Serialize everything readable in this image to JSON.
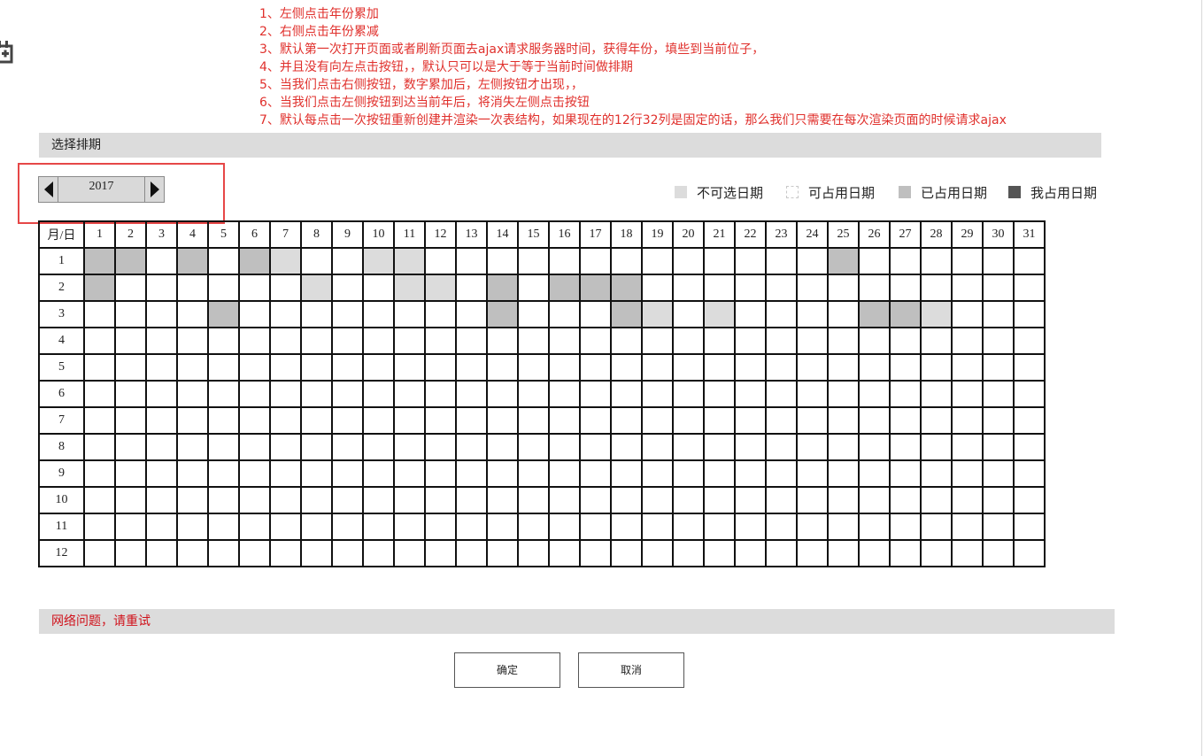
{
  "notes": [
    "1、左侧点击年份累加",
    "2、右侧点击年份累减",
    "3、默认第一次打开页面或者刷新页面去ajax请求服务器时间，获得年份，填些到当前位子，",
    "4、并且没有向左点击按钮，，默认只可以是大于等于当前时间做排期",
    "5、当我们点击右侧按钮，数字累加后，左侧按钮才出现，，",
    "6、当我们点击左侧按钮到达当前年后，将消失左侧点击按钮",
    "7、默认每点击一次按钮重新创建并渲染一次表结构，如果现在的12行32列是固定的话，那么我们只需要在每次渲染页面的时候请求ajax"
  ],
  "section_title": "选择排期",
  "year_picker": {
    "year": "2017"
  },
  "legend": [
    {
      "label": "不可选日期",
      "color": "#dcdcdc"
    },
    {
      "label": "可占用日期",
      "color": "#ffffff"
    },
    {
      "label": "已占用日期",
      "color": "#bfbfbf"
    },
    {
      "label": "我占用日期",
      "color": "#555555"
    }
  ],
  "table": {
    "corner_label": "月/日",
    "days": [
      "1",
      "2",
      "3",
      "4",
      "5",
      "6",
      "7",
      "8",
      "9",
      "10",
      "11",
      "12",
      "13",
      "14",
      "15",
      "16",
      "17",
      "18",
      "19",
      "20",
      "21",
      "22",
      "23",
      "24",
      "25",
      "26",
      "27",
      "28",
      "29",
      "30",
      "31"
    ],
    "months": [
      "1",
      "2",
      "3",
      "4",
      "5",
      "6",
      "7",
      "8",
      "9",
      "10",
      "11",
      "12"
    ],
    "cell_status": {
      "1": {
        "1": "occupied",
        "2": "occupied",
        "4": "occupied",
        "6": "occupied",
        "7": "unselectable",
        "10": "unselectable",
        "11": "unselectable",
        "25": "occupied"
      },
      "2": {
        "1": "occupied",
        "8": "unselectable",
        "11": "unselectable",
        "12": "unselectable",
        "14": "occupied",
        "16": "occupied",
        "17": "occupied",
        "18": "occupied"
      },
      "3": {
        "5": "occupied",
        "14": "occupied",
        "18": "occupied",
        "19": "unselectable",
        "21": "unselectable",
        "26": "occupied",
        "27": "occupied",
        "28": "unselectable"
      }
    }
  },
  "error_message": "网络问题，请重试",
  "buttons": {
    "confirm": "确定",
    "cancel": "取消"
  },
  "colors": {
    "accent_red": "#e0302c",
    "error_red": "#d0121b",
    "highlight_border": "#e64747"
  }
}
